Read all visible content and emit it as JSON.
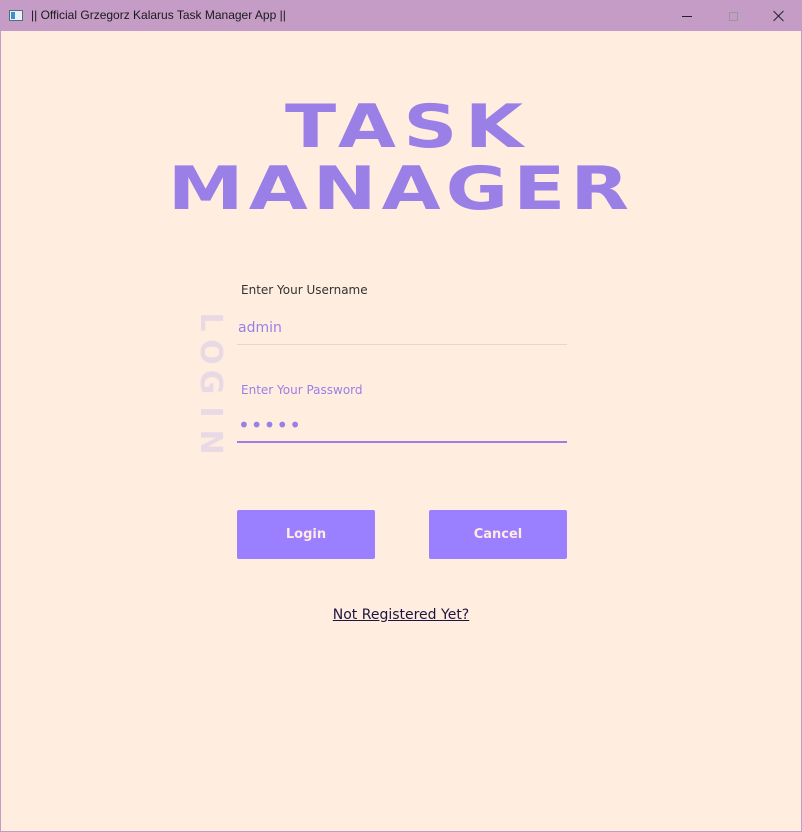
{
  "window": {
    "title": "|| Official Grzegorz Kalarus Task Manager App ||"
  },
  "logo": {
    "line1": "TASK",
    "line2": "MANAGER"
  },
  "side_label": [
    "L",
    "O",
    "G",
    "I",
    "N"
  ],
  "form": {
    "username_label": "Enter Your Username",
    "username_value": "admin",
    "password_label": "Enter Your Password",
    "password_value": "•••••"
  },
  "buttons": {
    "login": "Login",
    "cancel": "Cancel"
  },
  "register_link": "Not Registered Yet?",
  "colors": {
    "accent": "#9a7fff",
    "background": "#ffeee0",
    "titlebar": "#c49cc6"
  }
}
